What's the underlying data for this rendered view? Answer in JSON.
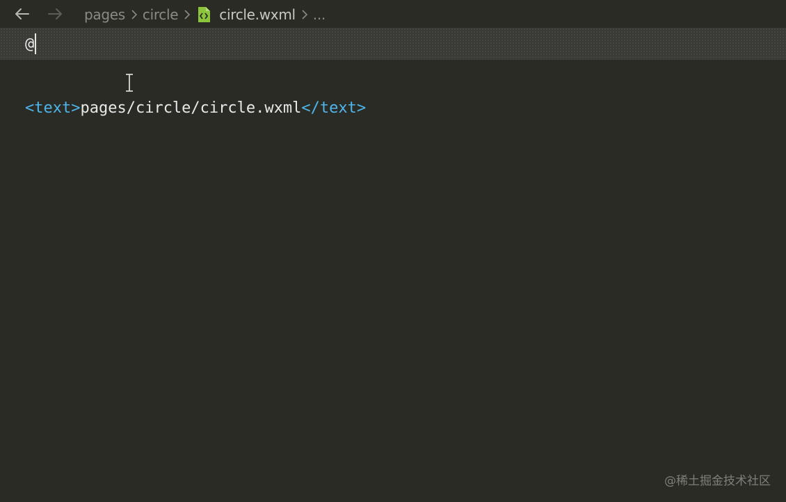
{
  "nav": {
    "back_icon": "arrow-left-icon",
    "forward_icon": "arrow-right-icon"
  },
  "breadcrumb": {
    "items": [
      "pages",
      "circle",
      "circle.wxml",
      "..."
    ],
    "file_icon": "wxml-file-icon",
    "separator_icon": "chevron-right-icon"
  },
  "editor": {
    "line1": "@",
    "line3": {
      "open_tag": "<text>",
      "content": "pages/circle/circle.wxml",
      "close_tag": "</text>"
    }
  },
  "watermark": "@稀土掘金技术社区",
  "colors": {
    "background": "#2b2b26",
    "tag": "#4fb6ea",
    "file_icon": "#8cc43c"
  }
}
